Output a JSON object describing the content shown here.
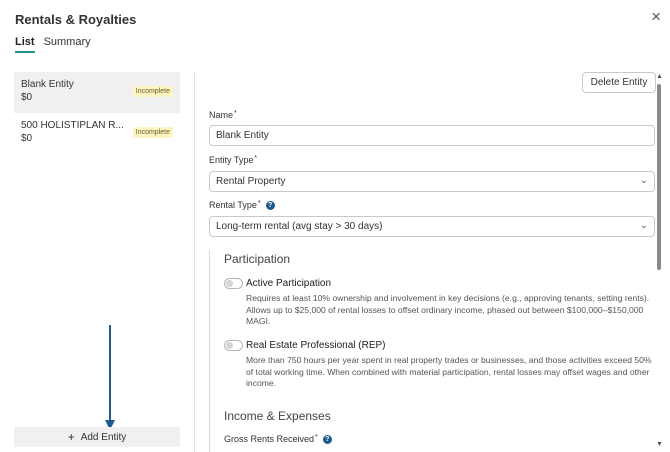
{
  "header": {
    "title": "Rentals & Royalties",
    "close_icon": "×"
  },
  "tabs": [
    {
      "label": "List",
      "active": true
    },
    {
      "label": "Summary",
      "active": false
    }
  ],
  "entities": [
    {
      "name": "Blank Entity",
      "amount": "$0",
      "status": "Incomplete",
      "selected": true
    },
    {
      "name": "500 HOLISTIPLAN R...",
      "amount": "$0",
      "status": "Incomplete",
      "selected": false
    }
  ],
  "add_entity": {
    "icon": "+",
    "label": "Add Entity"
  },
  "delete_button": "Delete Entity",
  "form": {
    "name_label": "Name",
    "name_value": "Blank Entity",
    "entity_type_label": "Entity Type",
    "entity_type_value": "Rental Property",
    "rental_type_label": "Rental Type",
    "rental_type_value": "Long-term rental (avg stay > 30 days)",
    "required_marker": "*",
    "help_icon": "?",
    "chevron_icon": "⌄"
  },
  "participation": {
    "title": "Participation",
    "options": [
      {
        "title": "Active Participation",
        "description": "Requires at least 10% ownership and involvement in key decisions (e.g., approving tenants, setting rents). Allows up to $25,000 of rental losses to offset ordinary income, phased out between $100,000–$150,000 MAGI.",
        "enabled": false
      },
      {
        "title": "Real Estate Professional (REP)",
        "description": "More than 750 hours per year spent in real property trades or businesses, and those activities exceed 50% of total working time. When combined with material participation, rental losses may offset wages and other income.",
        "enabled": false
      }
    ]
  },
  "income_expenses": {
    "title": "Income & Expenses",
    "gross_rents_label": "Gross Rents Received"
  },
  "scrollbar": {
    "up_icon": "▲",
    "down_icon": "▼"
  },
  "colors": {
    "accent": "#21968d",
    "arrow": "#1e5a8c",
    "badge_bg": "#fdf5c4",
    "help_icon": "#1e5a8c"
  }
}
